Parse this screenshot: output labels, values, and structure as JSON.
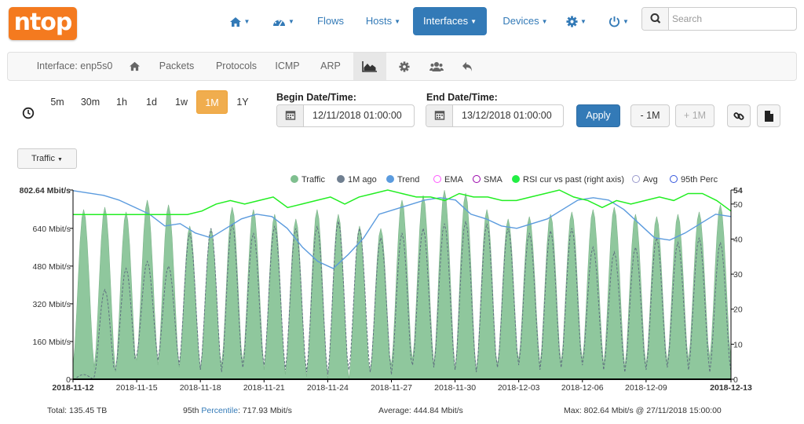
{
  "navbar": {
    "logo": "ntop",
    "flows": "Flows",
    "hosts": "Hosts",
    "interfaces": "Interfaces",
    "devices": "Devices",
    "search_placeholder": "Search"
  },
  "subnav": {
    "interface": "Interface: enp5s0",
    "packets": "Packets",
    "protocols": "Protocols",
    "icmp": "ICMP",
    "arp": "ARP"
  },
  "time_ranges": [
    "5m",
    "30m",
    "1h",
    "1d",
    "1w",
    "1M",
    "1Y"
  ],
  "selected_range": "1M",
  "begin": {
    "label": "Begin Date/Time:",
    "value": "12/11/2018 01:00:00"
  },
  "end": {
    "label": "End Date/Time:",
    "value": "13/12/2018 01:00:00"
  },
  "buttons": {
    "apply": "Apply",
    "minus": "- 1M",
    "plus": "+ 1M"
  },
  "metric_dropdown": "Traffic",
  "legend": [
    {
      "label": "Traffic",
      "color": "#7fbf8f",
      "style": "filled"
    },
    {
      "label": "1M ago",
      "color": "#707f90",
      "style": "filled"
    },
    {
      "label": "Trend",
      "color": "#5b9bde",
      "style": "filled"
    },
    {
      "label": "EMA",
      "color": "#ff55ff",
      "style": "hollow"
    },
    {
      "label": "SMA",
      "color": "#9900aa",
      "style": "hollow"
    },
    {
      "label": "RSI cur vs past (right axis)",
      "color": "#22ee44",
      "style": "filled"
    },
    {
      "label": "Avg",
      "color": "#9999cc",
      "style": "hollow"
    },
    {
      "label": "95th Perc",
      "color": "#3355dd",
      "style": "hollow"
    }
  ],
  "chart_data": {
    "type": "area",
    "x_range": [
      "2018-11-12",
      "2018-12-13"
    ],
    "x_ticks": [
      "2018-11-12",
      "2018-11-15",
      "2018-11-18",
      "2018-11-21",
      "2018-11-24",
      "2018-11-27",
      "2018-11-30",
      "2018-12-03",
      "2018-12-06",
      "2018-12-09",
      "2018-12-13"
    ],
    "y_left_ticks": [
      "0",
      "160 Mbit/s",
      "320 Mbit/s",
      "480 Mbit/s",
      "640 Mbit/s",
      "802.64 Mbit/s"
    ],
    "y_left_unit": "Mbit/s",
    "y_left_range": [
      0,
      802.64
    ],
    "y_right_ticks": [
      "0",
      "10",
      "20",
      "30",
      "40",
      "50",
      "54"
    ],
    "y_right_range": [
      0,
      54
    ],
    "series": [
      {
        "name": "Traffic",
        "color": "#8fc79d",
        "daily_peaks": [
          720,
          730,
          710,
          760,
          740,
          650,
          640,
          730,
          720,
          700,
          680,
          720,
          700,
          650,
          640,
          760,
          780,
          802,
          790,
          720,
          680,
          690,
          700,
          710,
          720,
          730,
          700,
          690,
          700,
          710,
          740
        ],
        "daily_troughs": [
          60,
          50,
          30,
          80,
          60,
          50,
          40,
          60,
          70,
          40,
          20,
          10,
          0,
          0,
          30,
          60,
          80,
          60,
          40,
          30,
          60,
          80,
          60,
          70,
          80,
          60,
          50,
          60,
          70,
          80,
          90
        ]
      },
      {
        "name": "1M ago",
        "color": "#5f6f80",
        "daily_peaks": [
          20,
          380,
          470,
          500,
          480,
          620,
          640,
          660,
          620,
          650,
          640,
          650,
          670,
          640,
          600,
          620,
          640,
          660,
          670,
          660,
          640,
          620,
          630,
          640,
          560,
          540,
          560,
          600,
          580,
          600,
          580
        ],
        "daily_troughs": [
          0,
          10,
          40,
          100,
          80,
          60,
          40,
          30,
          50,
          60,
          40,
          30,
          20,
          40,
          30,
          20,
          60,
          50,
          40,
          30,
          50,
          60,
          40,
          50,
          60,
          40,
          30,
          40,
          50,
          40,
          30
        ]
      },
      {
        "name": "Trend",
        "color": "#5b9bde",
        "values": [
          800,
          790,
          780,
          760,
          730,
          700,
          650,
          660,
          620,
          600,
          640,
          680,
          700,
          690,
          640,
          560,
          500,
          470,
          530,
          600,
          700,
          720,
          740,
          760,
          770,
          760,
          700,
          680,
          650,
          640,
          660,
          680,
          720,
          760,
          770,
          760,
          720,
          660,
          600,
          590,
          620,
          660,
          700,
          690
        ]
      },
      {
        "name": "RSI cur vs past (right axis)",
        "color": "#22ee22",
        "values_right_axis": [
          47,
          47,
          47,
          47,
          47,
          47,
          47,
          47,
          47,
          48,
          50,
          51,
          50,
          51,
          52,
          49,
          50,
          51,
          52,
          50,
          52,
          53,
          54,
          53,
          52,
          52,
          51,
          53,
          52,
          52,
          51,
          51,
          52,
          53,
          54,
          52,
          51,
          49,
          51,
          50,
          51,
          52,
          51,
          53,
          53,
          51,
          48
        ]
      }
    ]
  },
  "footer": {
    "total": "Total: 135.45 TB",
    "percentile_prefix": "95th ",
    "percentile_link": "Percentile",
    "percentile_value": ": 717.93 Mbit/s",
    "average": "Average: 444.84 Mbit/s",
    "max": "Max: 802.64 Mbit/s @ 27/11/2018 15:00:00"
  }
}
